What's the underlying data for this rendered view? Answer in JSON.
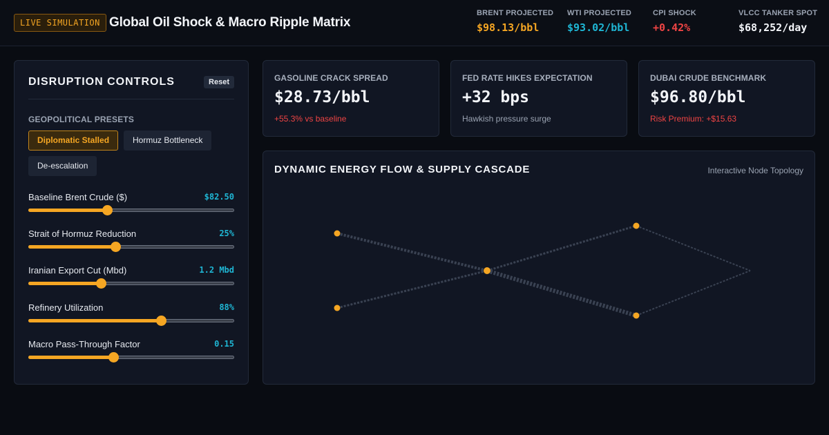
{
  "header": {
    "badge": "LIVE SIMULATION",
    "title": "Global Oil Shock & Macro Ripple Matrix",
    "metrics": [
      {
        "label": "BRENT PROJECTED",
        "value": "$98.13/bbl",
        "color": "#f5a623"
      },
      {
        "label": "WTI PROJECTED",
        "value": "$93.02/bbl",
        "color": "#1fb6d4"
      },
      {
        "label": "CPI SHOCK",
        "value": "+0.42%",
        "color": "#ef4444"
      },
      {
        "label": "VLCC TANKER SPOT",
        "value": "$68,252/day",
        "color": "#f2f4f8"
      }
    ]
  },
  "controls": {
    "title": "DISRUPTION CONTROLS",
    "reset_label": "Reset",
    "presets_label": "GEOPOLITICAL PRESETS",
    "presets": [
      {
        "label": "Diplomatic Stalled",
        "active": true
      },
      {
        "label": "Hormuz Bottleneck",
        "active": false
      },
      {
        "label": "De-escalation",
        "active": false
      }
    ],
    "sliders": [
      {
        "label": "Baseline Brent Crude ($)",
        "value": "$82.50",
        "fraction": 0.38
      },
      {
        "label": "Strait of Hormuz Reduction",
        "value": "25%",
        "fraction": 0.42
      },
      {
        "label": "Iranian Export Cut (Mbd)",
        "value": "1.2 Mbd",
        "fraction": 0.35
      },
      {
        "label": "Refinery Utilization",
        "value": "88%",
        "fraction": 0.64
      },
      {
        "label": "Macro Pass-Through Factor",
        "value": "0.15",
        "fraction": 0.41
      }
    ]
  },
  "kpis": [
    {
      "label": "GASOLINE CRACK SPREAD",
      "value": "$28.73/bbl",
      "sub": "+55.3% vs baseline",
      "sub_color": "#ef4444"
    },
    {
      "label": "FED RATE HIKES EXPECTATION",
      "value": "+32 bps",
      "sub": "Hawkish pressure surge",
      "sub_color": "#9aa3b2"
    },
    {
      "label": "DUBAI CRUDE BENCHMARK",
      "value": "$96.80/bbl",
      "sub": "Risk Premium: +$15.63",
      "sub_color": "#ef4444"
    }
  ],
  "flow": {
    "title": "DYNAMIC ENERGY FLOW & SUPPLY CASCADE",
    "subtitle": "Interactive Node Topology",
    "node_color": "#f5a623",
    "link_color": "#3a4252"
  }
}
